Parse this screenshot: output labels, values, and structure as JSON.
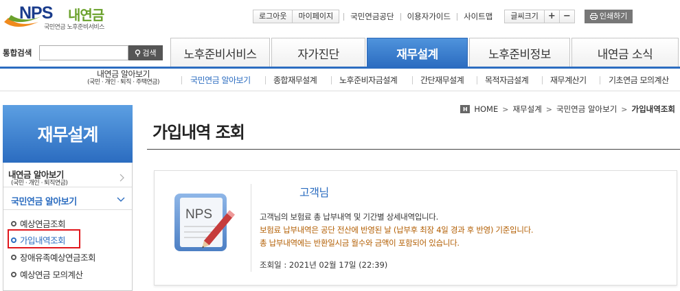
{
  "logo": {
    "brand": "NPS",
    "brand_kr": "내연금",
    "subtitle": "국민연금 노후준비서비스"
  },
  "util": {
    "logout": "로그아웃",
    "mypage": "마이페이지",
    "links": [
      "국민연금공단",
      "이용자가이드",
      "사이트맵"
    ],
    "fontsize_label": "글씨크기",
    "plus": "+",
    "minus": "−",
    "print": "인쇄하기"
  },
  "search": {
    "label": "통합검색",
    "placeholder": "",
    "button": "검색"
  },
  "gnb": {
    "tabs": [
      "노후준비서비스",
      "자가진단",
      "재무설계",
      "노후준비정보",
      "내연금 소식"
    ],
    "active_index": 2
  },
  "subnav": {
    "first_line1": "내연금 알아보기",
    "first_line2": "(국민 · 개인 · 퇴직 · 주택연금)",
    "items": [
      "국민연금 알아보기",
      "종합재무설계",
      "노후준비자금설계",
      "간단재무설계",
      "목적자금설계",
      "재무계산기",
      "기초연금 모의계산"
    ]
  },
  "sidebar": {
    "title": "재무설계",
    "item1": "내연금 알아보기",
    "item1_sub": "(국민 · 개인 · 퇴직연금)",
    "item2": "국민연금 알아보기",
    "subitems": [
      "예상연금조회",
      "가입내역조회",
      "장애유족예상연금조회",
      "예상연금 모의계산"
    ]
  },
  "breadcrumb": {
    "home_icon": "H",
    "home": "HOME",
    "level1": "재무설계",
    "level2": "국민연금 알아보기",
    "current": "가입내역조회"
  },
  "page": {
    "title": "가입내역 조회"
  },
  "info": {
    "icon_text": "NPS",
    "customer": "고객님",
    "line1": "고객님의 보험료 총 납부내역 및 기간별 상세내역입니다.",
    "line2": "보험료 납부내역은 공단 전산에 반영된 날 (납부후 최장 4일 경과 후 반영) 기준입니다.",
    "line3": "총 납부내역에는 반환일시금 월수와 금액이 포함되어 있습니다.",
    "query_date": "조회일 : 2021년 02월 17일 (22:39)"
  },
  "colors": {
    "accent": "#2b6cc0",
    "warning_text": "#b25d00",
    "highlight": "#e0161b"
  }
}
